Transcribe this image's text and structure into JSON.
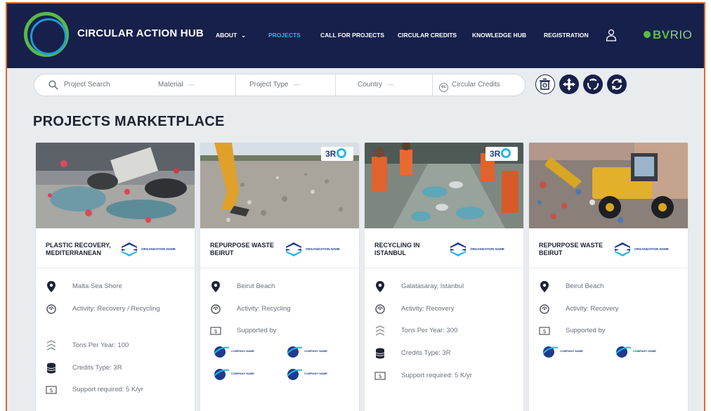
{
  "brand": {
    "name": "CIRCULAR ACTION HUB",
    "partner_logo_bold": "BV",
    "partner_logo_thin": "RIO"
  },
  "nav": {
    "items": [
      {
        "label": "ABOUT",
        "has_dropdown": true
      },
      {
        "label": "PROJECTS",
        "active": true
      },
      {
        "label": "CALL FOR PROJECTS"
      },
      {
        "label": "CIRCULAR CREDITS"
      },
      {
        "label": "KNOWLEDGE HUB"
      },
      {
        "label": "REGISTRATION"
      }
    ]
  },
  "search": {
    "placeholder": "Project Search",
    "filters": [
      {
        "label": "Material"
      },
      {
        "label": "Project Type"
      },
      {
        "label": "Country"
      }
    ],
    "credits_toggle": "Circular Credits"
  },
  "page_title": "PROJECTS MARKETPLACE",
  "colors": {
    "navy": "#17204a",
    "accent_blue": "#29b5e8",
    "green": "#5dbb46",
    "frame_orange": "#e36a2a"
  },
  "cards": [
    {
      "title": "PLASTIC RECOVERY, MEDITERRANEAN",
      "org": "ORGANIZATION NAME",
      "badge": false,
      "rows": [
        {
          "icon": "location-pin-icon",
          "text": "Malta Sea Shore"
        },
        {
          "icon": "recycle-icon",
          "text": "Activity: Recovery / Recycling"
        },
        {
          "icon": "waves-icon",
          "text": "Tons Per Year: 100"
        },
        {
          "icon": "database-icon",
          "text": "Credits Type: 3R"
        },
        {
          "icon": "dollar-icon",
          "text": "Support required: 5 K/yr"
        }
      ]
    },
    {
      "title": "REPURPOSE WASTE BEIRUT",
      "org": "ORGANIZATION NAME",
      "badge": true,
      "badge_text": "3R",
      "rows": [
        {
          "icon": "location-pin-icon",
          "text": "Beirut Beach"
        },
        {
          "icon": "recycle-icon",
          "text": "Activity: Recycling"
        },
        {
          "icon": "dollar-icon",
          "text": "Supported by"
        }
      ],
      "sponsors": [
        "COMPANY NAME",
        "COMPANY NAME",
        "COMPANY NAME",
        "COMPANY NAME"
      ]
    },
    {
      "title": "RECYCLING IN ISTANBUL",
      "org": "ORGANIZATION NAME",
      "badge": true,
      "badge_text": "3R",
      "rows": [
        {
          "icon": "location-pin-icon",
          "text": "Galatasaray, Istanbul"
        },
        {
          "icon": "recycle-icon",
          "text": "Activity: Recovery"
        },
        {
          "icon": "waves-icon",
          "text": "Tons Per Year: 300"
        },
        {
          "icon": "database-icon",
          "text": "Credits Type: 3R"
        },
        {
          "icon": "dollar-icon",
          "text": "Support required: 5 K/yr"
        }
      ]
    },
    {
      "title": "REPURPOSE WASTE BEIRUT",
      "org": "ORGANIZATION NAME",
      "badge": false,
      "rows": [
        {
          "icon": "location-pin-icon",
          "text": "Beirut Beach"
        },
        {
          "icon": "recycle-icon",
          "text": "Activity: Recovery"
        },
        {
          "icon": "dollar-icon",
          "text": "Supported by"
        }
      ],
      "sponsors": [
        "COMPANY NAME",
        "COMPANY NAME"
      ]
    }
  ]
}
